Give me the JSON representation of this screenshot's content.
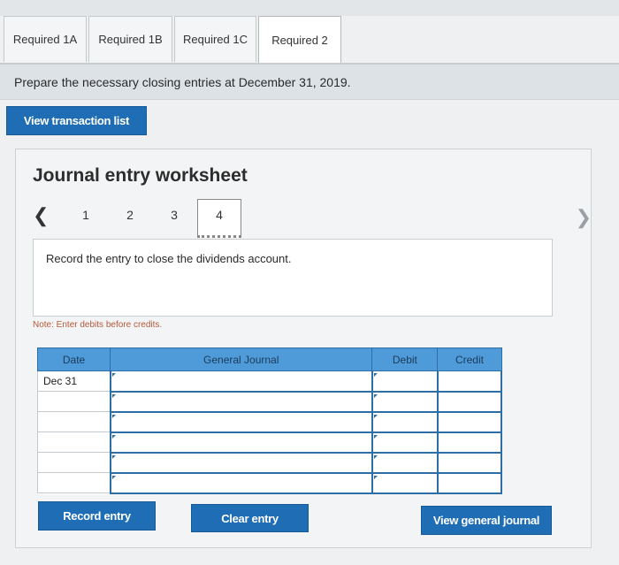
{
  "tabs": [
    {
      "label": "Required 1A",
      "active": false
    },
    {
      "label": "Required 1B",
      "active": false
    },
    {
      "label": "Required 1C",
      "active": false
    },
    {
      "label": "Required 2",
      "active": true
    }
  ],
  "instruction": "Prepare the necessary closing entries at December 31, 2019.",
  "view_transaction_list": "View transaction list",
  "worksheet": {
    "title": "Journal entry worksheet",
    "pager": {
      "prev_icon": "chevron-left-icon",
      "next_icon": "chevron-right-icon",
      "pages": [
        "1",
        "2",
        "3",
        "4"
      ],
      "active_page": "4"
    },
    "record_text": "Record the entry to close the dividends account.",
    "note": "Note: Enter debits before credits.",
    "table": {
      "headers": [
        "Date",
        "General Journal",
        "Debit",
        "Credit"
      ],
      "rows": [
        [
          "Dec 31",
          "",
          "",
          ""
        ],
        [
          "",
          "",
          "",
          ""
        ],
        [
          "",
          "",
          "",
          ""
        ],
        [
          "",
          "",
          "",
          ""
        ],
        [
          "",
          "",
          "",
          ""
        ],
        [
          "",
          "",
          "",
          ""
        ]
      ]
    },
    "buttons": {
      "record_entry": "Record entry",
      "clear_entry": "Clear entry",
      "view_general_journal": "View general journal"
    }
  },
  "colors": {
    "accent": "#1f6db5",
    "table_header": "#4f9bd9",
    "note": "#b4593b"
  }
}
